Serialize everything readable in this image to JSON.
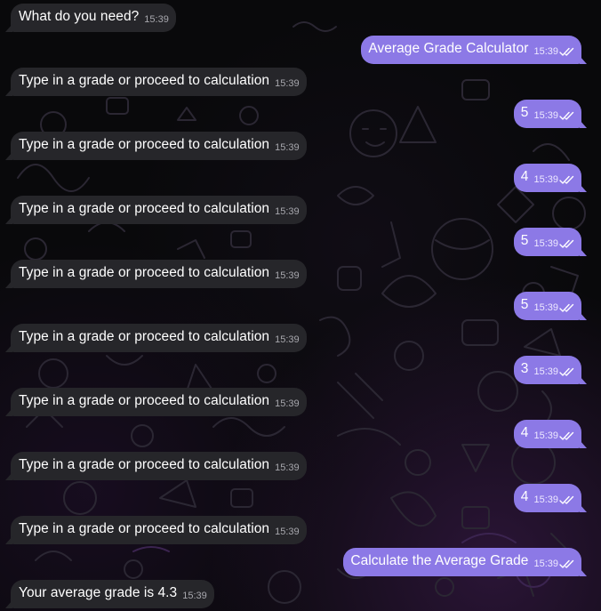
{
  "messages": [
    {
      "dir": "in",
      "text": "What do you need?",
      "time": "15:39"
    },
    {
      "dir": "out",
      "text": "Average Grade Calculator",
      "time": "15:39"
    },
    {
      "dir": "in",
      "text": "Type in a grade or proceed to calculation",
      "time": "15:39"
    },
    {
      "dir": "out",
      "text": "5",
      "time": "15:39"
    },
    {
      "dir": "in",
      "text": "Type in a grade or proceed to calculation",
      "time": "15:39"
    },
    {
      "dir": "out",
      "text": "4",
      "time": "15:39"
    },
    {
      "dir": "in",
      "text": "Type in a grade or proceed to calculation",
      "time": "15:39"
    },
    {
      "dir": "out",
      "text": "5",
      "time": "15:39"
    },
    {
      "dir": "in",
      "text": "Type in a grade or proceed to calculation",
      "time": "15:39"
    },
    {
      "dir": "out",
      "text": "5",
      "time": "15:39"
    },
    {
      "dir": "in",
      "text": "Type in a grade or proceed to calculation",
      "time": "15:39"
    },
    {
      "dir": "out",
      "text": "3",
      "time": "15:39"
    },
    {
      "dir": "in",
      "text": "Type in a grade or proceed to calculation",
      "time": "15:39"
    },
    {
      "dir": "out",
      "text": "4",
      "time": "15:39"
    },
    {
      "dir": "in",
      "text": "Type in a grade or proceed to calculation",
      "time": "15:39"
    },
    {
      "dir": "out",
      "text": "4",
      "time": "15:39"
    },
    {
      "dir": "in",
      "text": "Type in a grade or proceed to calculation",
      "time": "15:39"
    },
    {
      "dir": "out",
      "text": "Calculate the Average Grade",
      "time": "15:39"
    },
    {
      "dir": "in",
      "text": "Your average grade is 4.3",
      "time": "15:39"
    }
  ],
  "colors": {
    "incoming_bubble": "#26262a",
    "outgoing_bubble": "#8c79e6",
    "background": "#09090b",
    "doodle_stroke": "#2a2630"
  },
  "icons": {
    "read_status": "double-check-icon"
  }
}
